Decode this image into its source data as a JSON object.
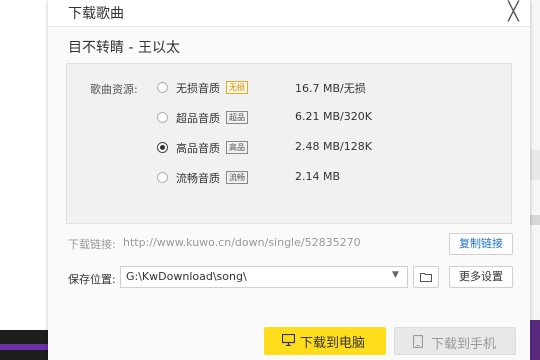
{
  "dialog": {
    "title": "下载歌曲",
    "close_glyph": "╳",
    "song_title": "目不转睛 - 王以太"
  },
  "quality": {
    "label": "歌曲资源:",
    "selected_index": 2,
    "options": [
      {
        "name": "无损音质",
        "badge": "无损",
        "size": "16.7 MB/无损"
      },
      {
        "name": "超品音质",
        "badge": "超品",
        "size": "6.21 MB/320K"
      },
      {
        "name": "高品音质",
        "badge": "高品",
        "size": "2.48 MB/128K"
      },
      {
        "name": "流畅音质",
        "badge": "流畅",
        "size": "2.14 MB"
      }
    ]
  },
  "link": {
    "label": "下载链接:",
    "url": "http://www.kuwo.cn/down/single/52835270",
    "copy_label": "复制链接"
  },
  "save": {
    "label": "保存位置:",
    "path": "G:\\KwDownload\\song\\",
    "more_label": "更多设置"
  },
  "actions": {
    "download_pc": "下载到电脑",
    "download_phone": "下载到手机"
  },
  "colors": {
    "accent_yellow": "#ffdd1a",
    "link_blue": "#1a6fd1"
  }
}
